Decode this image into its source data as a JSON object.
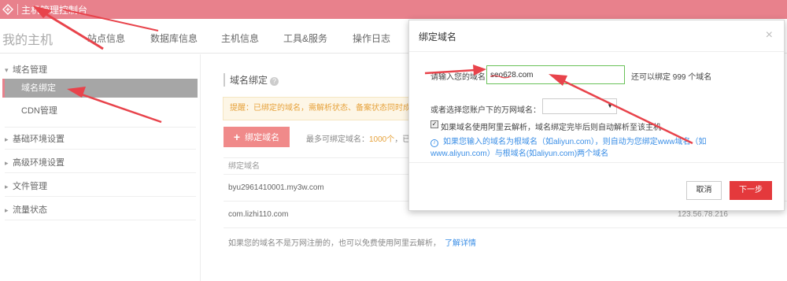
{
  "topbar": {
    "title": "主机管理控制台"
  },
  "nav": {
    "brand": "我的主机",
    "tabs": [
      "站点信息",
      "数据库信息",
      "主机信息",
      "工具&服务",
      "操作日志"
    ]
  },
  "sidebar": {
    "domain_group": "域名管理",
    "domain_bind": "域名绑定",
    "cdn": "CDN管理",
    "groups": [
      "基础环境设置",
      "高级环境设置",
      "文件管理",
      "流量状态"
    ]
  },
  "main": {
    "section_title": "域名绑定",
    "tip": "提醒：已绑定的域名，需解析状态、备案状态同时成功",
    "bind_button": "绑定域名",
    "max_prefix": "最多可绑定域名：",
    "max_num": "1000个",
    "max_suffix": "，已",
    "column_header": "绑定域名",
    "rows": [
      {
        "domain": "byu2961410001.my3w.com",
        "ip": ""
      },
      {
        "domain": "com.lizhi110.com",
        "ip": "123.56.78.216"
      }
    ],
    "footer_note": "如果您的域名不是万网注册的，也可以免费使用阿里云解析，",
    "footer_link": "了解详情"
  },
  "modal": {
    "title": "绑定域名",
    "close": "×",
    "input_label": "请输入您的域名:",
    "input_value": "seo628.com",
    "remaining": "还可以绑定 999 个域名",
    "select_label": "或者选择您账户下的万网域名：",
    "select_value": "",
    "checkbox_label": "如果域名使用阿里云解析，域名绑定完毕后则自动解析至该主机",
    "info_line1": "如果您输入的域名为根域名（如aliyun.com），则自动为您绑定www域名（如",
    "info_line2": "www.aliyun.com）与根域名(如aliyun.com)两个域名",
    "cancel": "取消",
    "next": "下一步"
  },
  "colors": {
    "topbar": "#e8818c",
    "primary_red": "#e4393c",
    "bind_button": "#f08a8a",
    "link_blue": "#3a8ee6",
    "input_border_green": "#6ac259",
    "annotation_arrow": "#e8434b"
  },
  "icons": {
    "logo": "aliyun-logo-icon",
    "help": "question-icon",
    "info": "info-icon",
    "plus": "plus-icon",
    "caret": "caret-icon"
  }
}
